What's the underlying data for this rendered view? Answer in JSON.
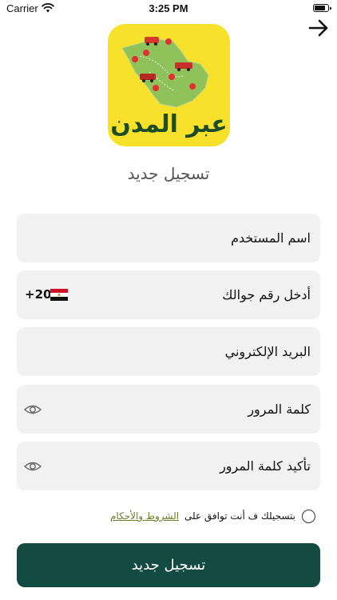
{
  "status_bar": {
    "carrier": "Carrier",
    "time": "3:25 PM",
    "battery_level": 0.9
  },
  "logo": {
    "text": "عبر المدن"
  },
  "page_title": "تسجيل جديد",
  "form": {
    "username_placeholder": "اسم المستخدم",
    "phone_placeholder": "أدخل رقم جوالك",
    "country_code": "+20",
    "email_placeholder": "البريد الإلكتروني",
    "password_placeholder": "كلمة المرور",
    "confirm_password_placeholder": "تأكيد كلمة المرور"
  },
  "terms": {
    "text": "بتسجيلك ف أنت توافق على",
    "link": "الشروط والأحكام"
  },
  "submit_label": "تسجيل جديد",
  "colors": {
    "primary": "#134b43",
    "logo_bg": "#f7e12b",
    "field_bg": "#f1f1f1",
    "link": "#6b7c2a"
  }
}
